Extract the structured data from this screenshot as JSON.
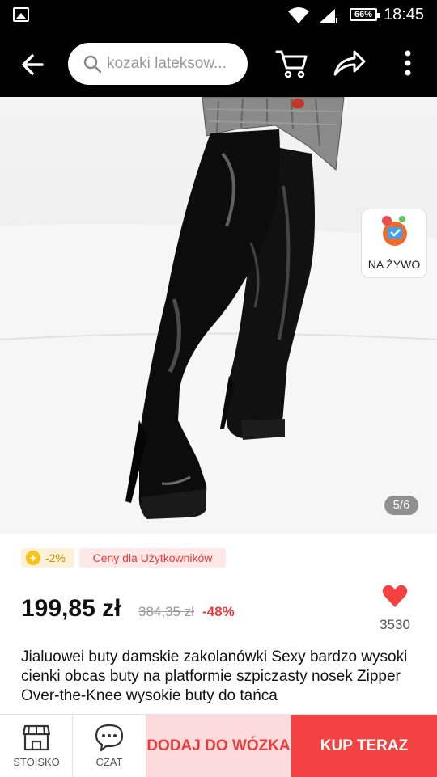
{
  "status_bar": {
    "battery": "66%",
    "time": "18:45"
  },
  "header": {
    "search_text": "kozaki lateksow..."
  },
  "gallery": {
    "counter": "5/6",
    "live_label": "NA ŻYWO"
  },
  "promo": {
    "coin_discount": "-2%",
    "user_prices_label": "Ceny dla Użytkowników"
  },
  "pricing": {
    "current_price": "199,85 zł",
    "original_price": "384,35 zł",
    "discount": "-48%",
    "likes": "3530"
  },
  "product": {
    "title": "Jialuowei buty damskie zakolanówki Sexy bardzo wysoki cienki obcas buty na platformie szpiczasty nosek Zipper Over-the-Knee wysokie buty do tańca"
  },
  "bottom_bar": {
    "store_label": "STOISKO",
    "chat_label": "CZAT",
    "add_to_cart_label": "DODAJ DO WÓZKA",
    "buy_now_label": "KUP TERAZ"
  },
  "colors": {
    "accent_red": "#f44243",
    "add_cart_bg": "#fddadb",
    "coin_yellow": "#f8c21c"
  }
}
